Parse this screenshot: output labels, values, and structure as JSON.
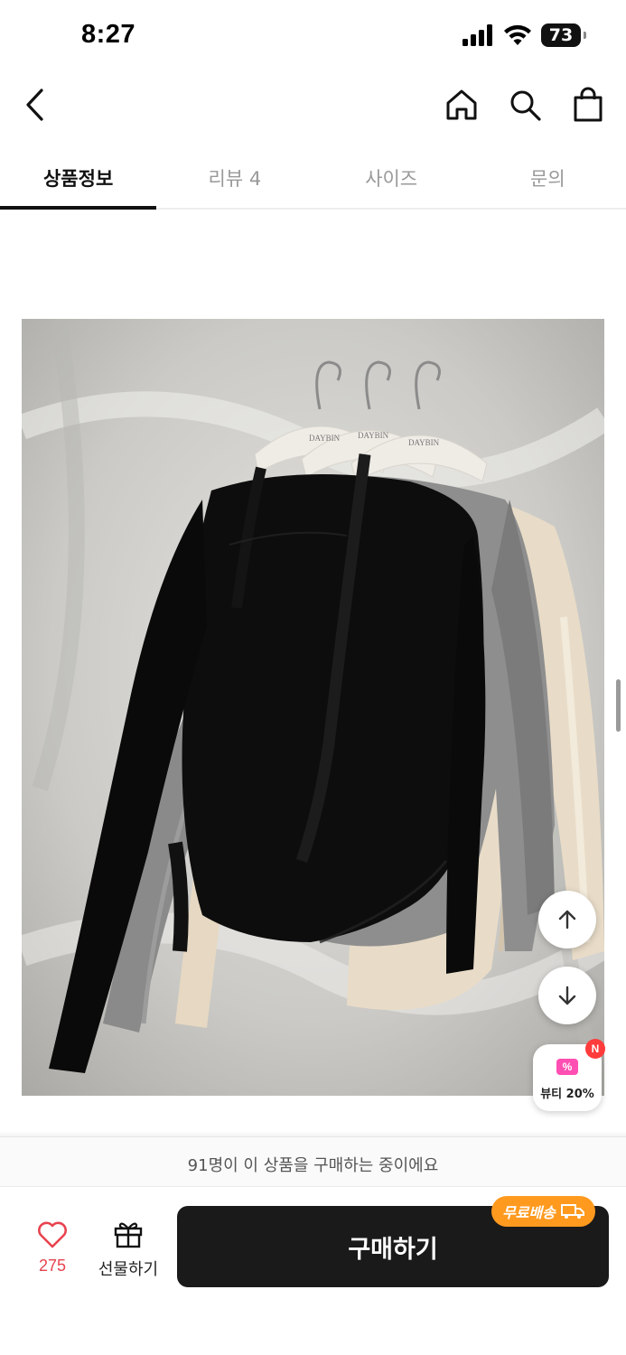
{
  "status_bar": {
    "time": "8:27",
    "battery": "73"
  },
  "nav": {
    "back_icon": "chevron-left-icon",
    "icons": [
      "home-icon",
      "search-icon",
      "shopping-bag-icon"
    ]
  },
  "tabs": [
    {
      "label": "상품정보",
      "active": true
    },
    {
      "label": "리뷰 4",
      "active": false
    },
    {
      "label": "사이즈",
      "active": false
    },
    {
      "label": "문의",
      "active": false
    }
  ],
  "product_image": {
    "description_icon": "product-photo",
    "hanger_brand": "DAYBIN"
  },
  "floating": {
    "up_icon": "arrow-up-icon",
    "down_icon": "arrow-down-icon",
    "beauty_label": "뷰티 20%",
    "new_badge": "N"
  },
  "buyers_notice": "91명이 이 상품을 구매하는 중이에요",
  "actions": {
    "like_count": "275",
    "gift_label": "선물하기",
    "buy_label": "구매하기",
    "free_shipping": "무료배송"
  },
  "colors": {
    "accent_red": "#e8434f",
    "buy_button": "#1a1a1a",
    "free_ship": "#ff9a1f"
  }
}
